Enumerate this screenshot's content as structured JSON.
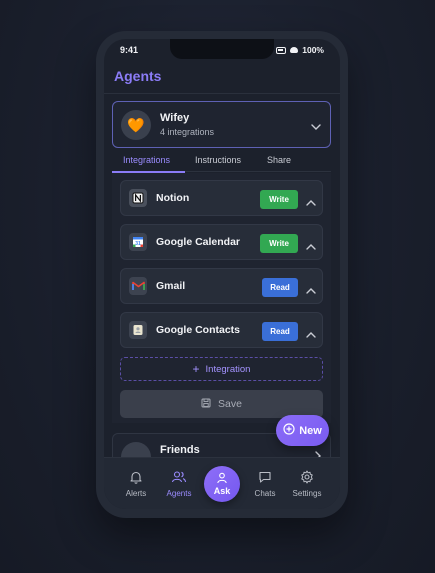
{
  "status_bar": {
    "time": "9:41",
    "battery": "100%"
  },
  "header": {
    "title": "Agents"
  },
  "agent": {
    "name": "Wifey",
    "subtitle": "4 integrations",
    "emoji": "🧡"
  },
  "tabs": [
    {
      "label": "Integrations",
      "active": true
    },
    {
      "label": "Instructions",
      "active": false
    },
    {
      "label": "Share",
      "active": false
    }
  ],
  "integrations": [
    {
      "name": "Notion",
      "permission": "Write",
      "icon": "notion-icon"
    },
    {
      "name": "Google Calendar",
      "permission": "Write",
      "icon": "google-calendar-icon"
    },
    {
      "name": "Gmail",
      "permission": "Read",
      "icon": "gmail-icon"
    },
    {
      "name": "Google Contacts",
      "permission": "Read",
      "icon": "google-contacts-icon"
    }
  ],
  "add_integration_label": "Integration",
  "save_label": "Save",
  "friends_agent": {
    "name": "Friends"
  },
  "new_button_label": "New",
  "nav": {
    "alerts": "Alerts",
    "agents": "Agents",
    "ask": "Ask",
    "chats": "Chats",
    "settings": "Settings"
  },
  "colors": {
    "accent": "#8b7cf6",
    "write_badge": "#32a852",
    "read_badge": "#3a6fd8"
  }
}
